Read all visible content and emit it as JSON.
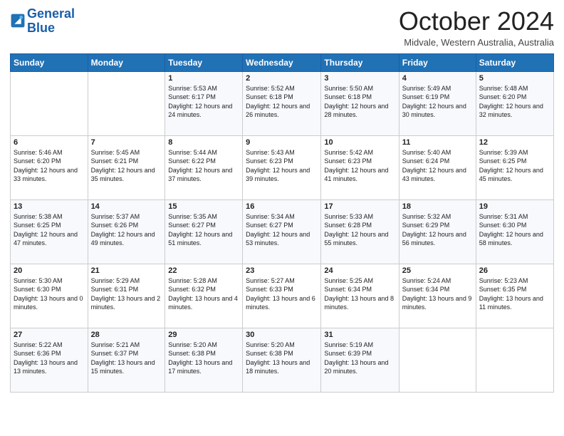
{
  "logo": {
    "line1": "General",
    "line2": "Blue"
  },
  "title": "October 2024",
  "subtitle": "Midvale, Western Australia, Australia",
  "days_of_week": [
    "Sunday",
    "Monday",
    "Tuesday",
    "Wednesday",
    "Thursday",
    "Friday",
    "Saturday"
  ],
  "weeks": [
    [
      {
        "day": "",
        "info": ""
      },
      {
        "day": "",
        "info": ""
      },
      {
        "day": "1",
        "info": "Sunrise: 5:53 AM\nSunset: 6:17 PM\nDaylight: 12 hours and 24 minutes."
      },
      {
        "day": "2",
        "info": "Sunrise: 5:52 AM\nSunset: 6:18 PM\nDaylight: 12 hours and 26 minutes."
      },
      {
        "day": "3",
        "info": "Sunrise: 5:50 AM\nSunset: 6:18 PM\nDaylight: 12 hours and 28 minutes."
      },
      {
        "day": "4",
        "info": "Sunrise: 5:49 AM\nSunset: 6:19 PM\nDaylight: 12 hours and 30 minutes."
      },
      {
        "day": "5",
        "info": "Sunrise: 5:48 AM\nSunset: 6:20 PM\nDaylight: 12 hours and 32 minutes."
      }
    ],
    [
      {
        "day": "6",
        "info": "Sunrise: 5:46 AM\nSunset: 6:20 PM\nDaylight: 12 hours and 33 minutes."
      },
      {
        "day": "7",
        "info": "Sunrise: 5:45 AM\nSunset: 6:21 PM\nDaylight: 12 hours and 35 minutes."
      },
      {
        "day": "8",
        "info": "Sunrise: 5:44 AM\nSunset: 6:22 PM\nDaylight: 12 hours and 37 minutes."
      },
      {
        "day": "9",
        "info": "Sunrise: 5:43 AM\nSunset: 6:23 PM\nDaylight: 12 hours and 39 minutes."
      },
      {
        "day": "10",
        "info": "Sunrise: 5:42 AM\nSunset: 6:23 PM\nDaylight: 12 hours and 41 minutes."
      },
      {
        "day": "11",
        "info": "Sunrise: 5:40 AM\nSunset: 6:24 PM\nDaylight: 12 hours and 43 minutes."
      },
      {
        "day": "12",
        "info": "Sunrise: 5:39 AM\nSunset: 6:25 PM\nDaylight: 12 hours and 45 minutes."
      }
    ],
    [
      {
        "day": "13",
        "info": "Sunrise: 5:38 AM\nSunset: 6:25 PM\nDaylight: 12 hours and 47 minutes."
      },
      {
        "day": "14",
        "info": "Sunrise: 5:37 AM\nSunset: 6:26 PM\nDaylight: 12 hours and 49 minutes."
      },
      {
        "day": "15",
        "info": "Sunrise: 5:35 AM\nSunset: 6:27 PM\nDaylight: 12 hours and 51 minutes."
      },
      {
        "day": "16",
        "info": "Sunrise: 5:34 AM\nSunset: 6:27 PM\nDaylight: 12 hours and 53 minutes."
      },
      {
        "day": "17",
        "info": "Sunrise: 5:33 AM\nSunset: 6:28 PM\nDaylight: 12 hours and 55 minutes."
      },
      {
        "day": "18",
        "info": "Sunrise: 5:32 AM\nSunset: 6:29 PM\nDaylight: 12 hours and 56 minutes."
      },
      {
        "day": "19",
        "info": "Sunrise: 5:31 AM\nSunset: 6:30 PM\nDaylight: 12 hours and 58 minutes."
      }
    ],
    [
      {
        "day": "20",
        "info": "Sunrise: 5:30 AM\nSunset: 6:30 PM\nDaylight: 13 hours and 0 minutes."
      },
      {
        "day": "21",
        "info": "Sunrise: 5:29 AM\nSunset: 6:31 PM\nDaylight: 13 hours and 2 minutes."
      },
      {
        "day": "22",
        "info": "Sunrise: 5:28 AM\nSunset: 6:32 PM\nDaylight: 13 hours and 4 minutes."
      },
      {
        "day": "23",
        "info": "Sunrise: 5:27 AM\nSunset: 6:33 PM\nDaylight: 13 hours and 6 minutes."
      },
      {
        "day": "24",
        "info": "Sunrise: 5:25 AM\nSunset: 6:34 PM\nDaylight: 13 hours and 8 minutes."
      },
      {
        "day": "25",
        "info": "Sunrise: 5:24 AM\nSunset: 6:34 PM\nDaylight: 13 hours and 9 minutes."
      },
      {
        "day": "26",
        "info": "Sunrise: 5:23 AM\nSunset: 6:35 PM\nDaylight: 13 hours and 11 minutes."
      }
    ],
    [
      {
        "day": "27",
        "info": "Sunrise: 5:22 AM\nSunset: 6:36 PM\nDaylight: 13 hours and 13 minutes."
      },
      {
        "day": "28",
        "info": "Sunrise: 5:21 AM\nSunset: 6:37 PM\nDaylight: 13 hours and 15 minutes."
      },
      {
        "day": "29",
        "info": "Sunrise: 5:20 AM\nSunset: 6:38 PM\nDaylight: 13 hours and 17 minutes."
      },
      {
        "day": "30",
        "info": "Sunrise: 5:20 AM\nSunset: 6:38 PM\nDaylight: 13 hours and 18 minutes."
      },
      {
        "day": "31",
        "info": "Sunrise: 5:19 AM\nSunset: 6:39 PM\nDaylight: 13 hours and 20 minutes."
      },
      {
        "day": "",
        "info": ""
      },
      {
        "day": "",
        "info": ""
      }
    ]
  ]
}
